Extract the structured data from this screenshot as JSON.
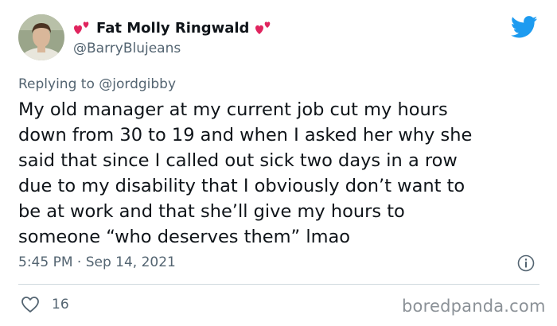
{
  "author": {
    "display_name": "Fat Molly Ringwald",
    "handle": "@BarryBlujeans",
    "name_emoji": "revolving-hearts-icon",
    "avatar": "avatar"
  },
  "reply": {
    "prefix": "Replying to",
    "mention": "@jordgibby"
  },
  "tweet": {
    "text": "My old manager at my current job cut my hours\ndown from 30 to 19 and when I asked her why she\nsaid that since I called out sick two days in a row\ndue to my disability that I obviously don’t want to\nbe at work and that she’ll give my hours to\nsomeone “who deserves them” lmao",
    "timestamp": "5:45 PM · Sep 14, 2021"
  },
  "stats": {
    "likes": "16"
  },
  "watermark": "boredpanda.com",
  "colors": {
    "twitter_blue": "#1d9bf0",
    "heart_red": "#e0245e",
    "secondary_text": "#536471",
    "divider": "#cfd9de"
  },
  "icons": {
    "brand": "twitter-bird-icon",
    "info": "info-icon",
    "like": "heart-outline-icon"
  }
}
